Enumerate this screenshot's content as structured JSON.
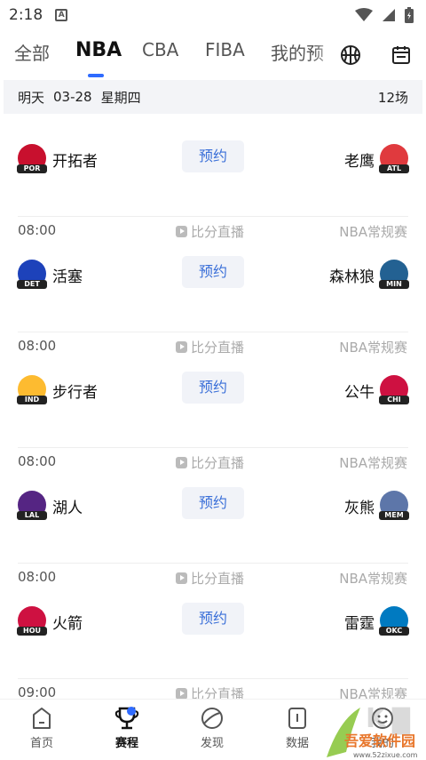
{
  "status_bar": {
    "time": "2:18",
    "a_icon": "A"
  },
  "tabs": [
    {
      "label": "全部",
      "active": false
    },
    {
      "label": "NBA",
      "active": true
    },
    {
      "label": "CBA",
      "active": false
    },
    {
      "label": "FIBA",
      "active": false
    },
    {
      "label": "我的预",
      "active": false
    }
  ],
  "header_icons": [
    "basketball-icon",
    "calendar-icon"
  ],
  "date_header": {
    "day": "明天",
    "date": "03-28",
    "weekday": "星期四",
    "count": "12场"
  },
  "action_label": "预约",
  "games": [
    {
      "time": "",
      "live": "",
      "league": "",
      "home": {
        "name": "开拓者",
        "abbr": "POR",
        "color": "#c8102e"
      },
      "away": {
        "name": "老鹰",
        "abbr": "ATL",
        "color": "#e03a3e"
      }
    },
    {
      "time": "08:00",
      "live": "比分直播",
      "league": "NBA常规赛",
      "home": {
        "name": "活塞",
        "abbr": "DET",
        "color": "#1d42ba"
      },
      "away": {
        "name": "森林狼",
        "abbr": "MIN",
        "color": "#236192"
      }
    },
    {
      "time": "08:00",
      "live": "比分直播",
      "league": "NBA常规赛",
      "home": {
        "name": "步行者",
        "abbr": "IND",
        "color": "#fdbb30"
      },
      "away": {
        "name": "公牛",
        "abbr": "CHI",
        "color": "#ce1141"
      }
    },
    {
      "time": "08:00",
      "live": "比分直播",
      "league": "NBA常规赛",
      "home": {
        "name": "湖人",
        "abbr": "LAL",
        "color": "#552583"
      },
      "away": {
        "name": "灰熊",
        "abbr": "MEM",
        "color": "#5d76a9"
      }
    },
    {
      "time": "08:00",
      "live": "比分直播",
      "league": "NBA常规赛",
      "home": {
        "name": "火箭",
        "abbr": "HOU",
        "color": "#ce1141"
      },
      "away": {
        "name": "雷霆",
        "abbr": "OKC",
        "color": "#007ac1"
      }
    },
    {
      "time": "09:00",
      "live": "比分直播",
      "league": "NBA常规赛",
      "home": null,
      "away": null
    }
  ],
  "bottom_nav": [
    {
      "label": "首页",
      "icon": "home-icon",
      "active": false
    },
    {
      "label": "赛程",
      "icon": "trophy-icon",
      "active": true
    },
    {
      "label": "发现",
      "icon": "discover-icon",
      "active": false
    },
    {
      "label": "数据",
      "icon": "data-icon",
      "active": false
    },
    {
      "label": "我的",
      "icon": "smiley-icon",
      "active": false
    }
  ],
  "watermark": {
    "text": "吾爱软件园",
    "url": "www.52zixue.com"
  }
}
